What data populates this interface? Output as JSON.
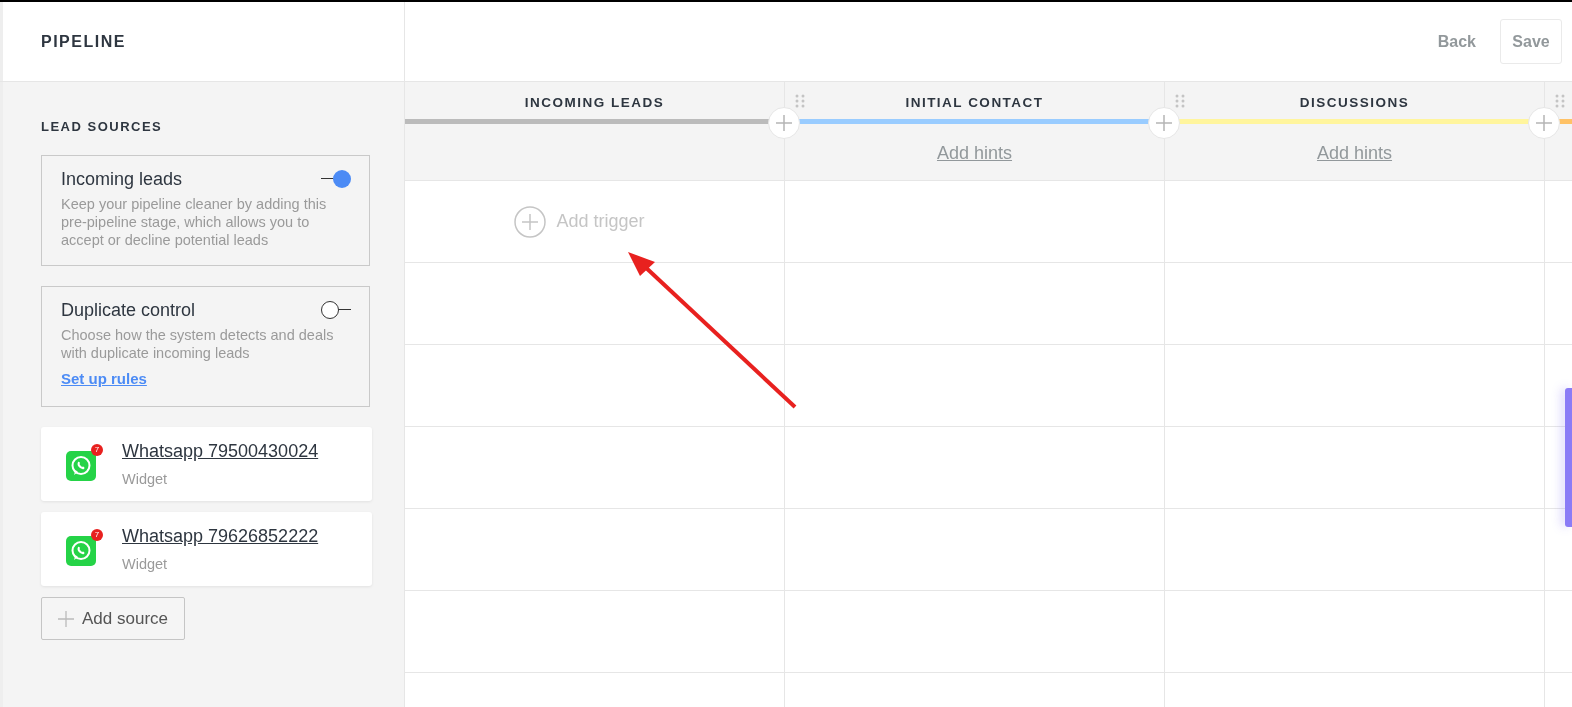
{
  "header": {
    "title": "PIPELINE",
    "back": "Back",
    "save": "Save"
  },
  "sidebar": {
    "heading": "LEAD SOURCES",
    "settings": [
      {
        "title": "Incoming leads",
        "description": "Keep your pipeline cleaner by adding this pre-pipeline stage, which allows you to accept or decline potential leads",
        "on": true
      },
      {
        "title": "Duplicate control",
        "description": "Choose how the system detects and deals with duplicate incoming leads",
        "link": "Set up rules",
        "on": false
      }
    ],
    "sources": [
      {
        "name": "Whatsapp 79500430024",
        "type": "Widget",
        "badge": "7"
      },
      {
        "name": "Whatsapp 79626852222",
        "type": "Widget",
        "badge": "7"
      }
    ],
    "add_source": "Add source"
  },
  "stages": [
    {
      "name": "INCOMING LEADS",
      "color": "#bbbbbb",
      "kind": "incoming",
      "trigger": "Add trigger"
    },
    {
      "name": "INITIAL CONTACT",
      "color": "#99ccff",
      "kind": "stage",
      "hints": "Add hints"
    },
    {
      "name": "DISCUSSIONS",
      "color": "#fff59d",
      "kind": "stage",
      "hints": "Add hints"
    },
    {
      "color": "#ffc266",
      "kind": "stage"
    }
  ]
}
